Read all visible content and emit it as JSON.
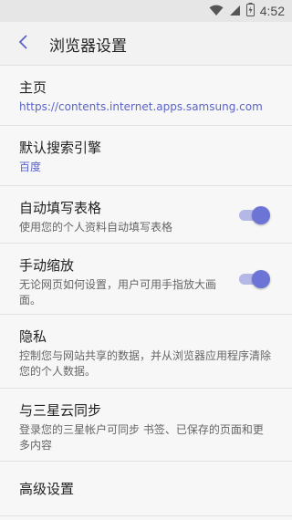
{
  "status_bar": {
    "time": "4:52",
    "icons": [
      "wifi-icon",
      "signal-icon",
      "battery-icon"
    ]
  },
  "header": {
    "title": "浏览器设置",
    "back_icon": "chevron-left-icon"
  },
  "colors": {
    "accent": "#5b63c8",
    "toggle_on": "#6c74d6"
  },
  "settings": [
    {
      "title": "主页",
      "subtitle": "https://contents.internet.apps.samsung.com",
      "accent": true
    },
    {
      "title": "默认搜索引擎",
      "subtitle": "百度",
      "accent": true
    },
    {
      "title": "自动填写表格",
      "subtitle": "使用您的个人资料自动填写表格",
      "toggle": true
    },
    {
      "title": "手动缩放",
      "subtitle": "无论网页如何设置，用户可用手指放大画面。",
      "toggle": true
    },
    {
      "title": "隐私",
      "subtitle": "控制您与网站共享的数据，并从浏览器应用程序清除您的个人数据。"
    },
    {
      "title": "与三星云同步",
      "subtitle": "登录您的三星帐户可同步 书签、已保存的页面和更多内容"
    },
    {
      "title": "高级设置"
    }
  ]
}
